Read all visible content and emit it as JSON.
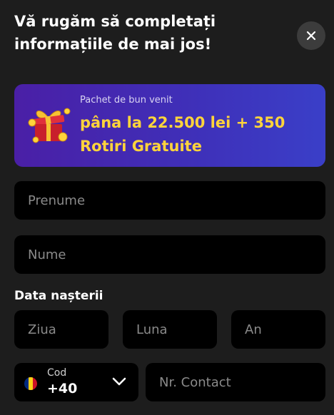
{
  "modal": {
    "title": "Vă rugăm să completați informațiile de mai jos!",
    "close_icon": "close-icon"
  },
  "banner": {
    "kicker": "Pachet de bun venit",
    "headline": "pâna la 22.500 lei + 350 Rotiri Gratuite",
    "icon": "gift-box-icon",
    "accent_color": "#ffd43b"
  },
  "form": {
    "first_name": {
      "placeholder": "Prenume",
      "value": ""
    },
    "last_name": {
      "placeholder": "Nume",
      "value": ""
    },
    "birth_date": {
      "label": "Data nașterii",
      "day": {
        "placeholder": "Ziua",
        "value": ""
      },
      "month": {
        "placeholder": "Luna",
        "value": ""
      },
      "year": {
        "placeholder": "An",
        "value": ""
      }
    },
    "phone": {
      "country_code_label": "Cod",
      "country_code_value": "+40",
      "country_flag": "romania-flag-icon",
      "number": {
        "placeholder": "Nr. Contact",
        "value": ""
      }
    }
  },
  "colors": {
    "background": "#1d1d1d",
    "field_background": "#000000",
    "banner_gradient_start": "#4a1fa6",
    "banner_gradient_end": "#3a3fc8",
    "flag_blue": "#002b7f",
    "flag_yellow": "#fcd116",
    "flag_red": "#ce1126"
  }
}
